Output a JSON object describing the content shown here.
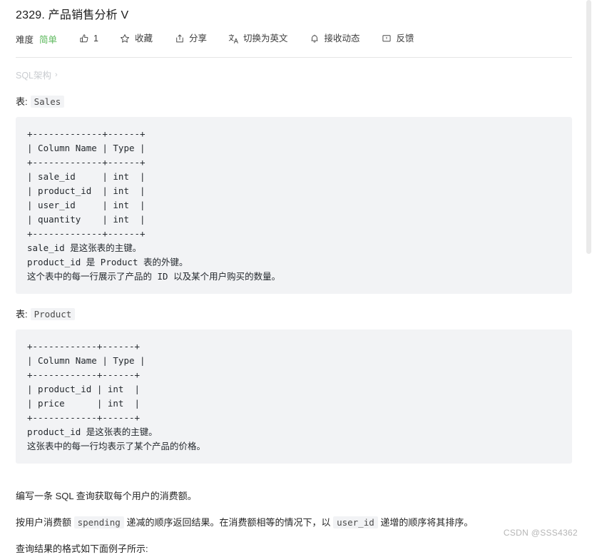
{
  "header": {
    "title": "2329. 产品销售分析 V"
  },
  "toolbar": {
    "difficulty_label": "难度",
    "difficulty_value": "简单",
    "difficulty_color": "#5cb85c",
    "items": [
      {
        "icon": "thumbs-up-icon",
        "label": "1"
      },
      {
        "icon": "star-icon",
        "label": "收藏"
      },
      {
        "icon": "share-icon",
        "label": "分享"
      },
      {
        "icon": "translate-icon",
        "label": "切换为英文"
      },
      {
        "icon": "bell-icon",
        "label": "接收动态"
      },
      {
        "icon": "feedback-icon",
        "label": "反馈"
      }
    ]
  },
  "breadcrumb": {
    "crumb": "SQL架构",
    "separator": "›"
  },
  "sections": [
    {
      "caption_label": "表:",
      "caption_code": "Sales",
      "code": "+-------------+------+\n| Column Name | Type |\n+-------------+------+\n| sale_id     | int  |\n| product_id  | int  |\n| user_id     | int  |\n| quantity    | int  |\n+-------------+------+\nsale_id 是这张表的主键。\nproduct_id 是 Product 表的外键。\n这个表中的每一行展示了产品的 ID 以及某个用户购买的数量。"
    },
    {
      "caption_label": "表:",
      "caption_code": "Product",
      "code": "+------------+------+\n| Column Name | Type |\n+------------+------+\n| product_id | int  |\n| price      | int  |\n+------------+------+\nproduct_id 是这张表的主键。\n这张表中的每一行均表示了某个产品的价格。"
    }
  ],
  "body": {
    "p1": "编写一条 SQL 查询获取每个用户的消费额。",
    "p2_a": "按用户消费额 ",
    "p2_code1": "spending",
    "p2_b": " 递减的顺序返回结果。在消费额相等的情况下，以 ",
    "p2_code2": "user_id",
    "p2_c": " 递增的顺序将其排序。",
    "p3": "查询结果的格式如下面例子所示:"
  },
  "watermark": "CSDN @SSS4362"
}
